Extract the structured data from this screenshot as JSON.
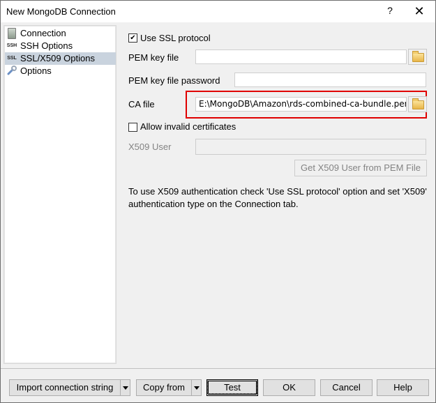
{
  "window": {
    "title": "New MongoDB Connection",
    "help_label": "?",
    "close_label": "✕"
  },
  "sidebar": {
    "items": [
      {
        "label": "Connection",
        "icon": "server-icon",
        "selected": false
      },
      {
        "label": "SSH Options",
        "icon": "ssh-icon",
        "icon_text": "SSH",
        "selected": false
      },
      {
        "label": "SSL/X509 Options",
        "icon": "ssl-icon",
        "icon_text": "SSL",
        "selected": true
      },
      {
        "label": "Options",
        "icon": "wrench-icon",
        "selected": false
      }
    ]
  },
  "form": {
    "use_ssl": {
      "label": "Use SSL protocol",
      "checked": true,
      "mark": "✔"
    },
    "pem_key_file": {
      "label": "PEM key file",
      "value": ""
    },
    "pem_key_password": {
      "label": "PEM key file password",
      "value": ""
    },
    "ca_file": {
      "label": "CA file",
      "value": "E:\\MongoDB\\Amazon\\rds-combined-ca-bundle.pem"
    },
    "allow_invalid": {
      "label": "Allow invalid certificates",
      "checked": false
    },
    "x509_user": {
      "label": "X509 User",
      "value": ""
    },
    "get_x509_button": "Get X509 User from PEM File",
    "info_text": "To use X509 authentication check 'Use SSL protocol' option and set 'X509' authentication type on the Connection tab."
  },
  "footer": {
    "import_button": "Import connection string",
    "copy_from_button": "Copy from",
    "test_button": "Test",
    "ok_button": "OK",
    "cancel_button": "Cancel",
    "help_button": "Help"
  },
  "colors": {
    "highlight": "#e00000",
    "selection": "#c9d3de"
  }
}
